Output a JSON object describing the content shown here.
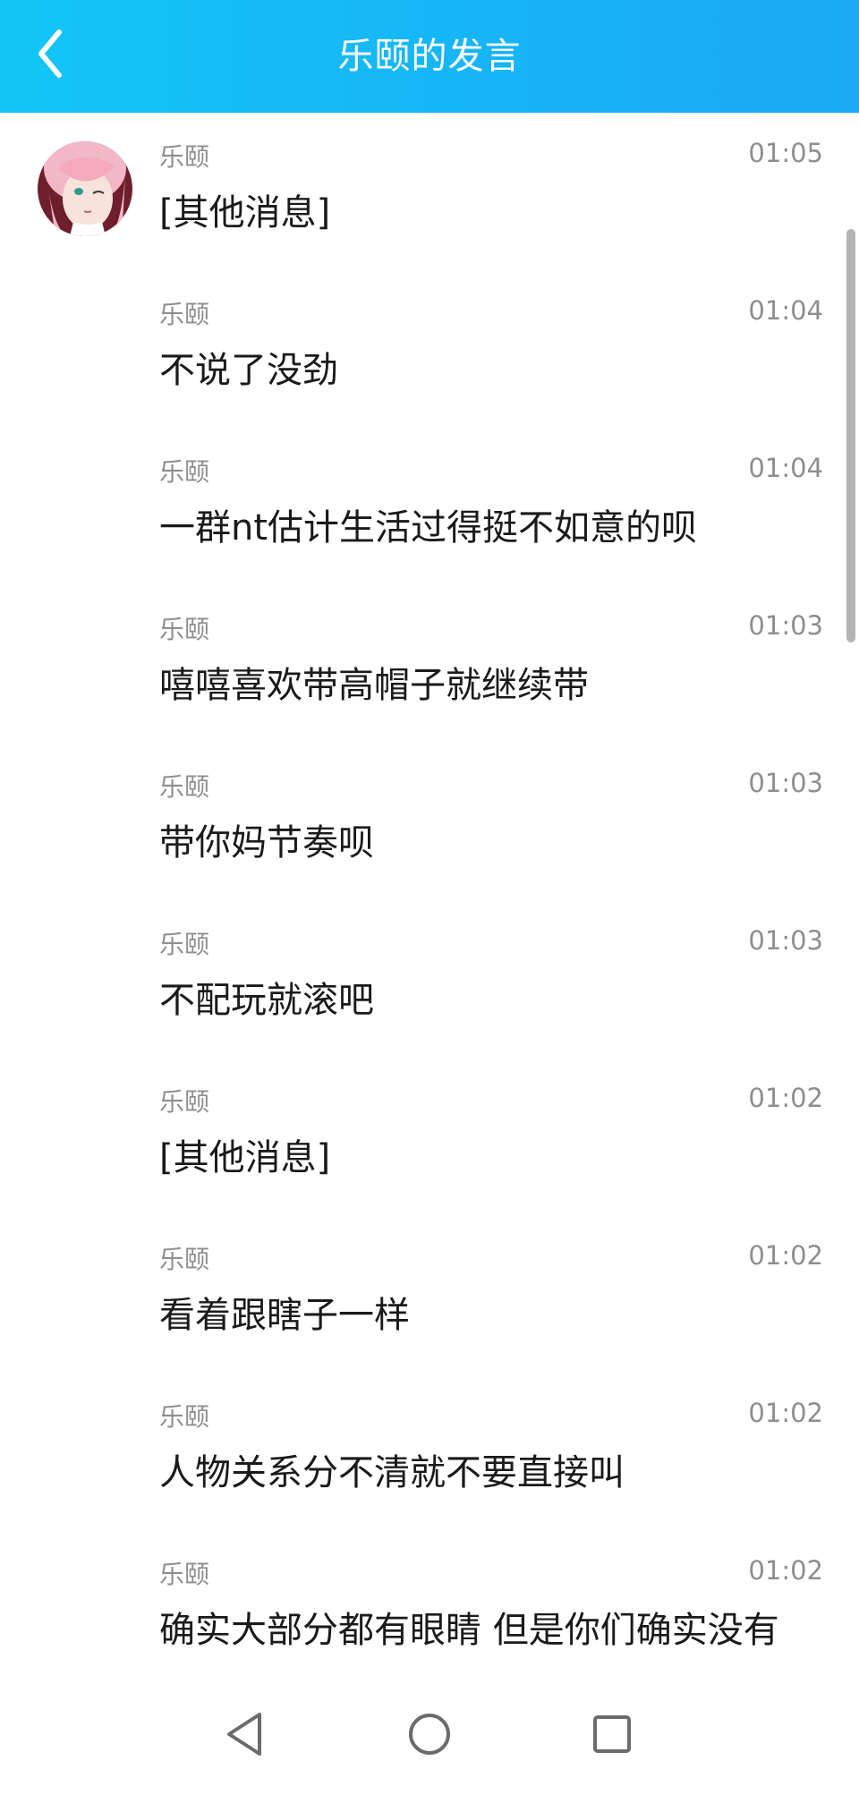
{
  "header": {
    "title": "乐颐的发言",
    "back_icon": "chevron-left-icon"
  },
  "messages": [
    {
      "sender": "乐颐",
      "time": "01:05",
      "text": "[其他消息]",
      "show_avatar": true
    },
    {
      "sender": "乐颐",
      "time": "01:04",
      "text": "不说了没劲",
      "show_avatar": false
    },
    {
      "sender": "乐颐",
      "time": "01:04",
      "text": "一群nt估计生活过得挺不如意的呗",
      "show_avatar": false
    },
    {
      "sender": "乐颐",
      "time": "01:03",
      "text": "嘻嘻喜欢带高帽子就继续带",
      "show_avatar": false
    },
    {
      "sender": "乐颐",
      "time": "01:03",
      "text": "带你妈节奏呗",
      "show_avatar": false
    },
    {
      "sender": "乐颐",
      "time": "01:03",
      "text": "不配玩就滚吧",
      "show_avatar": false
    },
    {
      "sender": "乐颐",
      "time": "01:02",
      "text": "[其他消息]",
      "show_avatar": false
    },
    {
      "sender": "乐颐",
      "time": "01:02",
      "text": "看着跟瞎子一样",
      "show_avatar": false
    },
    {
      "sender": "乐颐",
      "time": "01:02",
      "text": "人物关系分不清就不要直接叫",
      "show_avatar": false
    },
    {
      "sender": "乐颐",
      "time": "01:02",
      "text": "确实大部分都有眼睛 但是你们确实没有",
      "show_avatar": false
    }
  ],
  "navbar": {
    "back_icon": "triangle-back-icon",
    "home_icon": "circle-home-icon",
    "recents_icon": "square-recents-icon"
  },
  "colors": {
    "header_start": "#13c5f7",
    "header_end": "#1aa8f5",
    "meta_text": "#8e8e8e",
    "body_text": "#1a1a1a"
  }
}
